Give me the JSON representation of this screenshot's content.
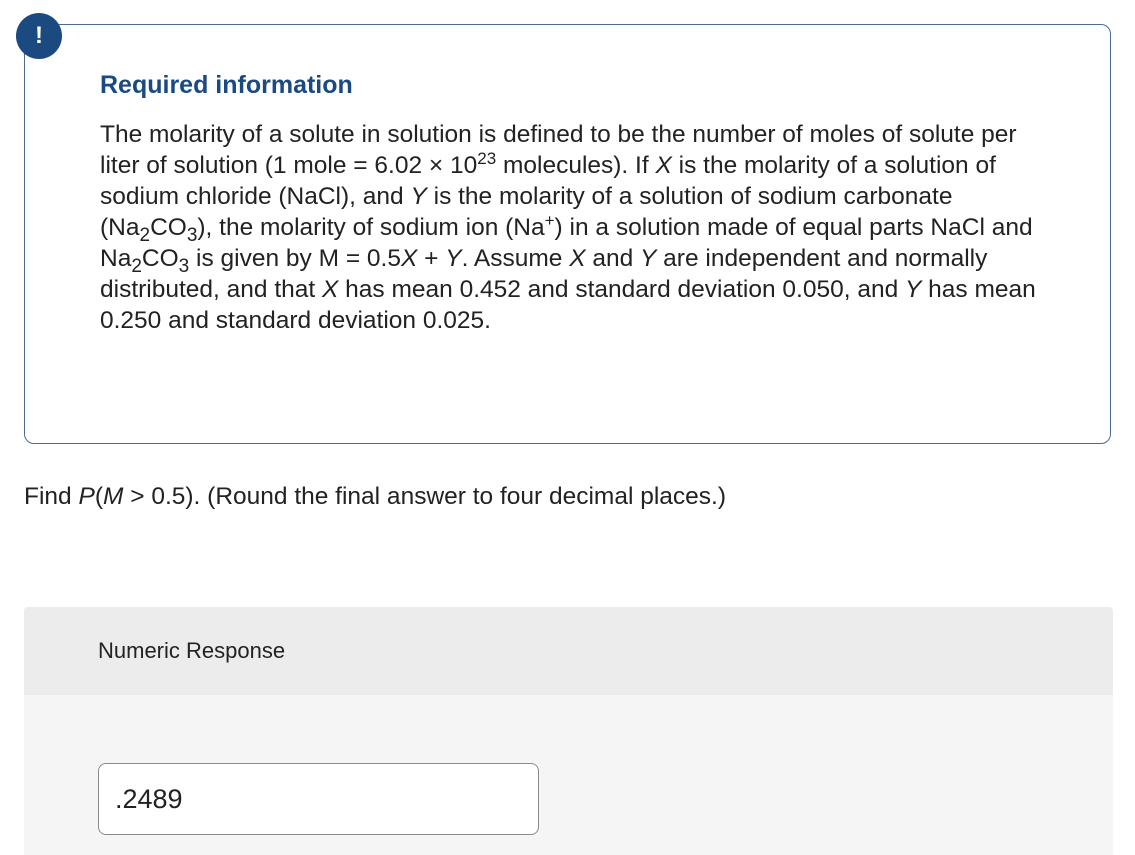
{
  "alert": {
    "symbol": "!",
    "icon": "exclamation-icon",
    "color": "#1a4a80"
  },
  "info": {
    "title": "Required information",
    "parts": {
      "p1": "The molarity of a solute in solution is defined to be the number of moles of solute per liter of solution (1 mole = 6.02 × 10",
      "exp1": "23",
      "p2": " molecules). If ",
      "var_x": "X",
      "p3": " is the molarity of a solution of sodium chloride (NaCl), and ",
      "var_y": "Y",
      "p4": " is the molarity of a solution of sodium carbonate (Na",
      "sub1": "2",
      "p5": "CO",
      "sub2": "3",
      "p6": "), the molarity of sodium ion (Na",
      "sup_plus": "+",
      "p7": ") in a solution made of equal parts NaCl and Na",
      "sub3": "2",
      "p8": "CO",
      "sub4": "3",
      "p9": " is given by M = 0.5",
      "var_x2": "X",
      "p10": " + ",
      "var_y2": "Y",
      "p11": ". Assume ",
      "var_x3": "X",
      "p12": " and ",
      "var_y3": "Y",
      "p13": " are independent and normally distributed, and that ",
      "var_x4": "X",
      "p14": " has mean 0.452 and standard deviation 0.050, and ",
      "var_y4": "Y",
      "p15": " has mean 0.250 and standard deviation 0.025."
    }
  },
  "question": {
    "pre": "Find ",
    "p": "P",
    "open": "(",
    "m": "M",
    "rest": " > 0.5). (Round the final answer to four decimal places.)"
  },
  "response": {
    "label": "Numeric Response",
    "value": ".2489"
  },
  "colors": {
    "accent": "#1a4a80",
    "border": "#4e6a8c",
    "panel": "#f5f5f5",
    "panel_header": "#ececec"
  }
}
